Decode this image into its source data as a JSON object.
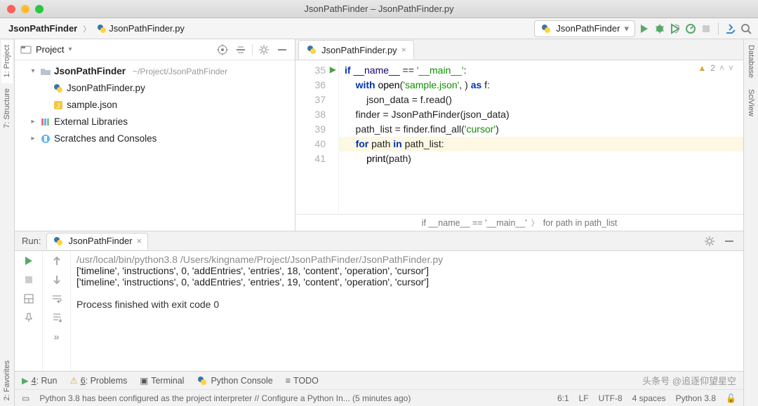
{
  "window": {
    "title": "JsonPathFinder – JsonPathFinder.py"
  },
  "traffic_colors": [
    "#ff5f57",
    "#febc2e",
    "#28c840"
  ],
  "breadcrumbs": [
    {
      "label": "JsonPathFinder",
      "bold": true,
      "icon": "folder"
    },
    {
      "label": "JsonPathFinder.py",
      "icon": "py"
    }
  ],
  "run_config": {
    "label": "JsonPathFinder"
  },
  "toolbar_right": [
    "run",
    "debug",
    "coverage",
    "profile",
    "stop-disabled",
    "git",
    "search"
  ],
  "left_rail": [
    {
      "label": "1: Project",
      "active": true
    },
    {
      "label": "7: Structure",
      "active": false
    },
    {
      "label": "2: Favorites",
      "active": false
    }
  ],
  "right_rail": [
    {
      "label": "Database"
    },
    {
      "label": "SciView"
    }
  ],
  "project_pane": {
    "header": "Project",
    "tree": [
      {
        "depth": 1,
        "arrow": "▾",
        "icon": "folder",
        "label": "JsonPathFinder",
        "suffix": "~/Project/JsonPathFinder",
        "bold": true
      },
      {
        "depth": 2,
        "arrow": "",
        "icon": "py",
        "label": "JsonPathFinder.py"
      },
      {
        "depth": 2,
        "arrow": "",
        "icon": "json",
        "label": "sample.json"
      },
      {
        "depth": 1,
        "arrow": "▸",
        "icon": "lib",
        "label": "External Libraries"
      },
      {
        "depth": 1,
        "arrow": "▸",
        "icon": "scratch",
        "label": "Scratches and Consoles"
      }
    ]
  },
  "editor": {
    "tab_label": "JsonPathFinder.py",
    "first_line_no": 35,
    "warn_count": "2",
    "current_line_index": 5,
    "lines": [
      {
        "segs": [
          {
            "t": "if ",
            "c": "kw"
          },
          {
            "t": "__name__",
            "c": "nm"
          },
          {
            "t": " == "
          },
          {
            "t": "'__main__'",
            "c": "str"
          },
          {
            "t": ":"
          }
        ]
      },
      {
        "segs": [
          {
            "t": "    "
          },
          {
            "t": "with ",
            "c": "kw"
          },
          {
            "t": "open",
            "c": "fn"
          },
          {
            "t": "("
          },
          {
            "t": "'sample.json'",
            "c": "str"
          },
          {
            "t": ", ) "
          },
          {
            "t": "as ",
            "c": "kw"
          },
          {
            "t": "f:"
          }
        ]
      },
      {
        "segs": [
          {
            "t": "        json_data = f.read()"
          }
        ]
      },
      {
        "segs": [
          {
            "t": "    finder = JsonPathFinder(json_data)"
          }
        ]
      },
      {
        "segs": [
          {
            "t": "    path_list = finder.find_all("
          },
          {
            "t": "'cursor'",
            "c": "str"
          },
          {
            "t": ")"
          }
        ]
      },
      {
        "segs": [
          {
            "t": "    "
          },
          {
            "t": "for ",
            "c": "kw"
          },
          {
            "t": "path "
          },
          {
            "t": "in ",
            "c": "kw"
          },
          {
            "t": "path_list:"
          }
        ]
      },
      {
        "segs": [
          {
            "t": "        "
          },
          {
            "t": "print",
            "c": "fn"
          },
          {
            "t": "(path)"
          }
        ]
      }
    ],
    "crumb": [
      "if __name__ == '__main__'",
      "for path in path_list"
    ]
  },
  "run_panel": {
    "title": "Run:",
    "tab": "JsonPathFinder",
    "cmd": "/usr/local/bin/python3.8 /Users/kingname/Project/JsonPathFinder/JsonPathFinder.py",
    "out": [
      "['timeline', 'instructions', 0, 'addEntries', 'entries', 18, 'content', 'operation', 'cursor']",
      "['timeline', 'instructions', 0, 'addEntries', 'entries', 19, 'content', 'operation', 'cursor']"
    ],
    "exit": "Process finished with exit code 0"
  },
  "bottom_tabs": [
    {
      "icon": "run",
      "label": "4: Run",
      "u": "4"
    },
    {
      "icon": "problems",
      "label": "6: Problems",
      "u": "6"
    },
    {
      "icon": "terminal",
      "label": "Terminal"
    },
    {
      "icon": "pyconsole",
      "label": "Python Console"
    },
    {
      "icon": "todo",
      "label": "TODO"
    }
  ],
  "status": {
    "msg": "Python 3.8 has been configured as the project interpreter // Configure a Python In... (5 minutes ago)",
    "pos": "6:1",
    "sep": "LF",
    "enc": "UTF-8",
    "indent": "4 spaces",
    "interp": "Python 3.8",
    "watermark": "头条号 @追逐仰望星空"
  }
}
